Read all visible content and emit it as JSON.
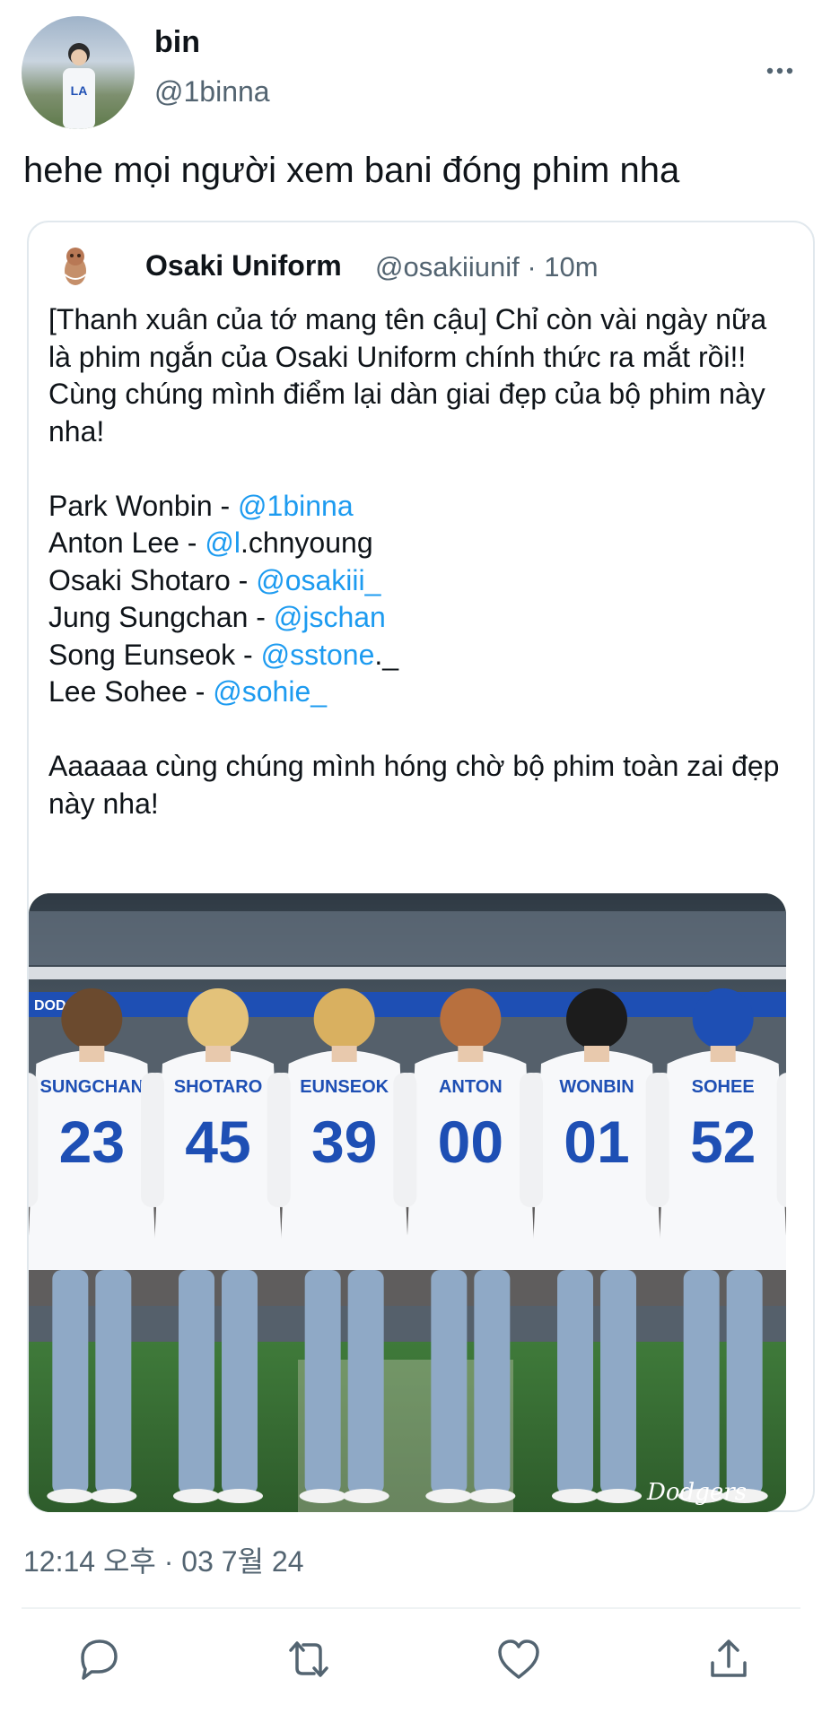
{
  "author": {
    "display_name": "bin",
    "handle": "@1binna"
  },
  "tweet_text": "hehe mọi người xem bani đóng phim nha",
  "quote": {
    "display_name": "Osaki Uniform",
    "meta": "@osakiiunif · 10m",
    "intro": "[Thanh xuân của tớ mang tên cậu] Chỉ còn vài ngày nữa là phim ngắn của Osaki Uniform chính thức ra mắt rồi!! Cùng chúng mình điểm lại dàn giai đẹp của bộ phim này nha!",
    "cast": [
      {
        "name": "Park Wonbin - ",
        "mention": "@1binna",
        "rest": ""
      },
      {
        "name": "Anton Lee - ",
        "mention": "@l",
        "rest": ".chnyoung"
      },
      {
        "name": "Osaki Shotaro - ",
        "mention": "@osakiii_",
        "rest": ""
      },
      {
        "name": "Jung Sungchan - ",
        "mention": "@jschan",
        "rest": ""
      },
      {
        "name": "Song Eunseok - ",
        "mention": "@sstone",
        "rest": "._"
      },
      {
        "name": "Lee Sohee - ",
        "mention": "@sohie_",
        "rest": ""
      }
    ],
    "outro": "Aaaaaa cùng chúng mình hóng chờ bộ phim toàn zai đẹp này nha!",
    "photo": {
      "stadium_sign": "DOD  S   IUM",
      "watermark": "Dodgers",
      "players": [
        {
          "name": "SUNGCHAN",
          "number": "23"
        },
        {
          "name": "SHOTARO",
          "number": "45"
        },
        {
          "name": "EUNSEOK",
          "number": "39"
        },
        {
          "name": "ANTON",
          "number": "00"
        },
        {
          "name": "WONBIN",
          "number": "01"
        },
        {
          "name": "SOHEE",
          "number": "52"
        }
      ]
    }
  },
  "timestamp": "12:14 오후 · 03 7월 24",
  "icons": {
    "reply": "reply-icon",
    "retweet": "retweet-icon",
    "like": "heart-icon",
    "share": "share-icon",
    "more": "more-icon"
  },
  "colors": {
    "link": "#1d9bf0",
    "secondary": "#536471",
    "jersey_blue": "#1e4fb4"
  }
}
